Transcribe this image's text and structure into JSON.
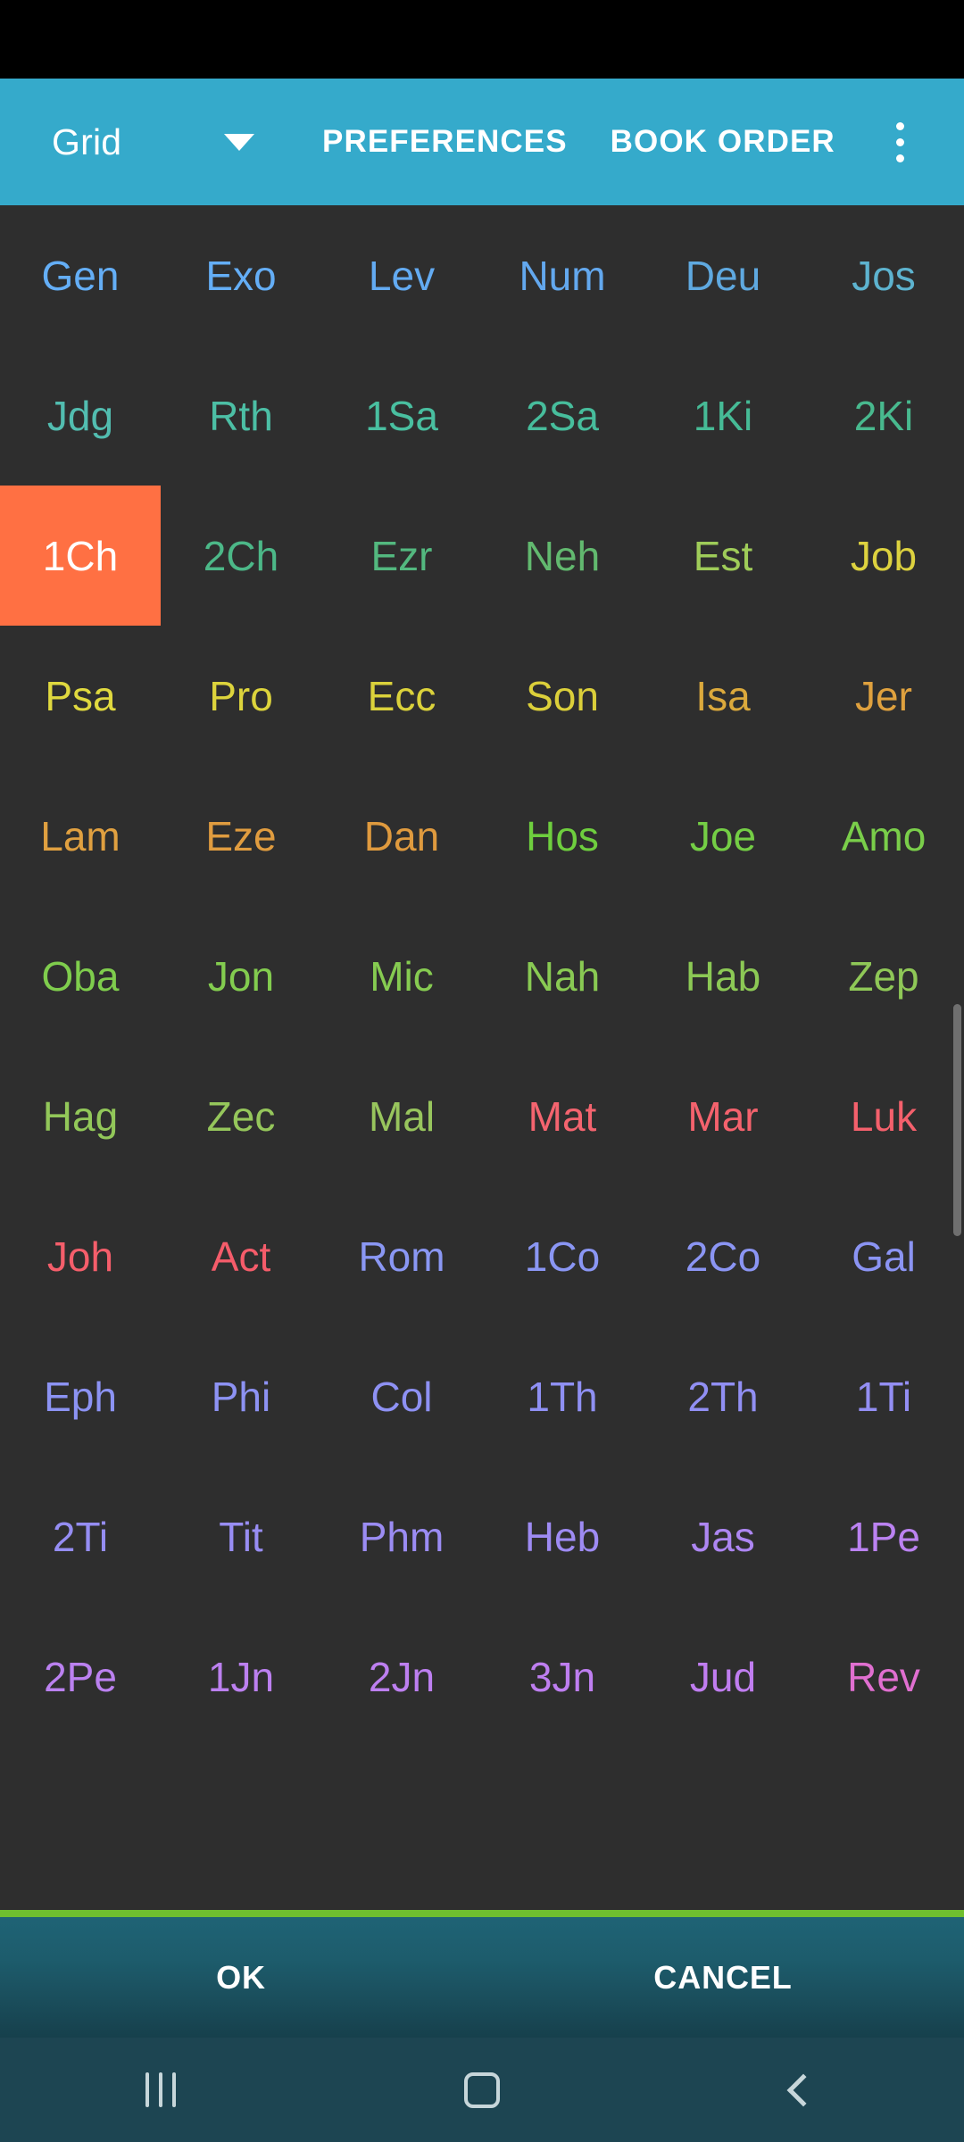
{
  "window": {
    "title": "Book selection grid"
  },
  "toolbar": {
    "spinner_value": "Grid",
    "spinner_icon": "chevron-down-icon",
    "preferences_label": "PREFERENCES",
    "book_order_label": "BOOK ORDER",
    "overflow_icon": "more-vertical-icon"
  },
  "grid": {
    "columns": 6,
    "selected": "1Ch",
    "selected_bg": "#ff7043",
    "selected_fg": "#ffffff",
    "background": "#2e2e2e",
    "books": [
      {
        "label": "Gen",
        "color": "#64aef6"
      },
      {
        "label": "Exo",
        "color": "#64aef6"
      },
      {
        "label": "Lev",
        "color": "#63abf2"
      },
      {
        "label": "Num",
        "color": "#63a8ee"
      },
      {
        "label": "Deu",
        "color": "#5fa9e0"
      },
      {
        "label": "Jos",
        "color": "#5db3cf"
      },
      {
        "label": "Jdg",
        "color": "#52bdb0"
      },
      {
        "label": "Rth",
        "color": "#4cbfa5"
      },
      {
        "label": "1Sa",
        "color": "#49bfa0"
      },
      {
        "label": "2Sa",
        "color": "#47bd9c"
      },
      {
        "label": "1Ki",
        "color": "#46bb96"
      },
      {
        "label": "2Ki",
        "color": "#48b98e"
      },
      {
        "label": "1Ch",
        "color": "#ffffff"
      },
      {
        "label": "2Ch",
        "color": "#4cb888"
      },
      {
        "label": "Ezr",
        "color": "#53b87f"
      },
      {
        "label": "Neh",
        "color": "#62b96f"
      },
      {
        "label": "Est",
        "color": "#9fcc59"
      },
      {
        "label": "Job",
        "color": "#ddd23f"
      },
      {
        "label": "Psa",
        "color": "#e0d93f"
      },
      {
        "label": "Pro",
        "color": "#ddd43c"
      },
      {
        "label": "Ecc",
        "color": "#dbd23b"
      },
      {
        "label": "Son",
        "color": "#dbcf3a"
      },
      {
        "label": "Isa",
        "color": "#dba93c"
      },
      {
        "label": "Jer",
        "color": "#dfa13e"
      },
      {
        "label": "Lam",
        "color": "#e0a040"
      },
      {
        "label": "Eze",
        "color": "#e09c3f"
      },
      {
        "label": "Dan",
        "color": "#df9a3e"
      },
      {
        "label": "Hos",
        "color": "#6ece3e"
      },
      {
        "label": "Joe",
        "color": "#74ce45"
      },
      {
        "label": "Amo",
        "color": "#7ace4a"
      },
      {
        "label": "Oba",
        "color": "#7fcd4d"
      },
      {
        "label": "Jon",
        "color": "#83cc4f"
      },
      {
        "label": "Mic",
        "color": "#86cb51"
      },
      {
        "label": "Nah",
        "color": "#89ca53"
      },
      {
        "label": "Hab",
        "color": "#8cc955"
      },
      {
        "label": "Zep",
        "color": "#8fc857"
      },
      {
        "label": "Hag",
        "color": "#92c759"
      },
      {
        "label": "Zec",
        "color": "#95c65b"
      },
      {
        "label": "Mal",
        "color": "#98c55d"
      },
      {
        "label": "Mat",
        "color": "#f4646f"
      },
      {
        "label": "Mar",
        "color": "#f4626d"
      },
      {
        "label": "Luk",
        "color": "#f4606c"
      },
      {
        "label": "Joh",
        "color": "#f55e6b"
      },
      {
        "label": "Act",
        "color": "#f55c6a"
      },
      {
        "label": "Rom",
        "color": "#8a97f3"
      },
      {
        "label": "1Co",
        "color": "#8a96f3"
      },
      {
        "label": "2Co",
        "color": "#8b95f3"
      },
      {
        "label": "Gal",
        "color": "#8b94f3"
      },
      {
        "label": "Eph",
        "color": "#8c93f3"
      },
      {
        "label": "Phi",
        "color": "#8d92f3"
      },
      {
        "label": "Col",
        "color": "#8e91f3"
      },
      {
        "label": "1Th",
        "color": "#8f90f3"
      },
      {
        "label": "2Th",
        "color": "#918ff3"
      },
      {
        "label": "1Ti",
        "color": "#938ef3"
      },
      {
        "label": "2Ti",
        "color": "#958df3"
      },
      {
        "label": "Tit",
        "color": "#988df3"
      },
      {
        "label": "Phm",
        "color": "#9b8cf3"
      },
      {
        "label": "Heb",
        "color": "#9e8bf3"
      },
      {
        "label": "Jas",
        "color": "#ad86f2"
      },
      {
        "label": "1Pe",
        "color": "#bb82f1"
      },
      {
        "label": "2Pe",
        "color": "#bb81f0"
      },
      {
        "label": "1Jn",
        "color": "#bc80f0"
      },
      {
        "label": "2Jn",
        "color": "#bd7ff0"
      },
      {
        "label": "3Jn",
        "color": "#be7ef0"
      },
      {
        "label": "Jud",
        "color": "#c07df0"
      },
      {
        "label": "Rev",
        "color": "#e06fd0"
      }
    ]
  },
  "divider": {
    "color": "#6fbf2f"
  },
  "button_bar": {
    "ok_label": "OK",
    "cancel_label": "CANCEL"
  },
  "nav_bar": {
    "recents_icon": "recents-icon",
    "home_icon": "home-icon",
    "back_icon": "back-icon"
  }
}
